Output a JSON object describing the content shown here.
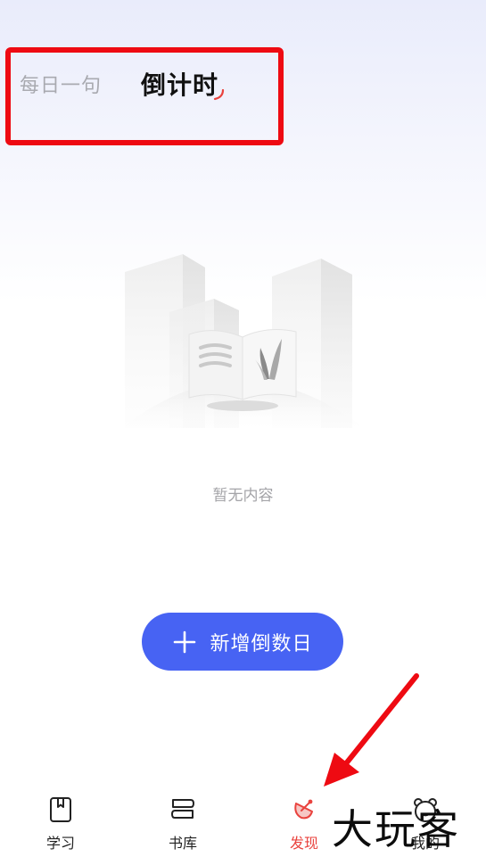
{
  "tabs": {
    "inactive_label": "每日一句",
    "active_label": "倒计时"
  },
  "empty_state": {
    "message": "暂无内容"
  },
  "actions": {
    "add_label": "新增倒数日"
  },
  "bottom_nav": {
    "items": [
      {
        "label": "学习",
        "icon": "book-icon"
      },
      {
        "label": "书库",
        "icon": "stacked-books-icon"
      },
      {
        "label": "发现",
        "icon": "satellite-dish-icon",
        "active": true
      },
      {
        "label": "我的",
        "icon": "bear-face-icon"
      }
    ]
  },
  "watermark": "大玩客",
  "colors": {
    "accent": "#4763f3",
    "active_nav": "#e9433e",
    "highlight": "#ee0a12"
  }
}
